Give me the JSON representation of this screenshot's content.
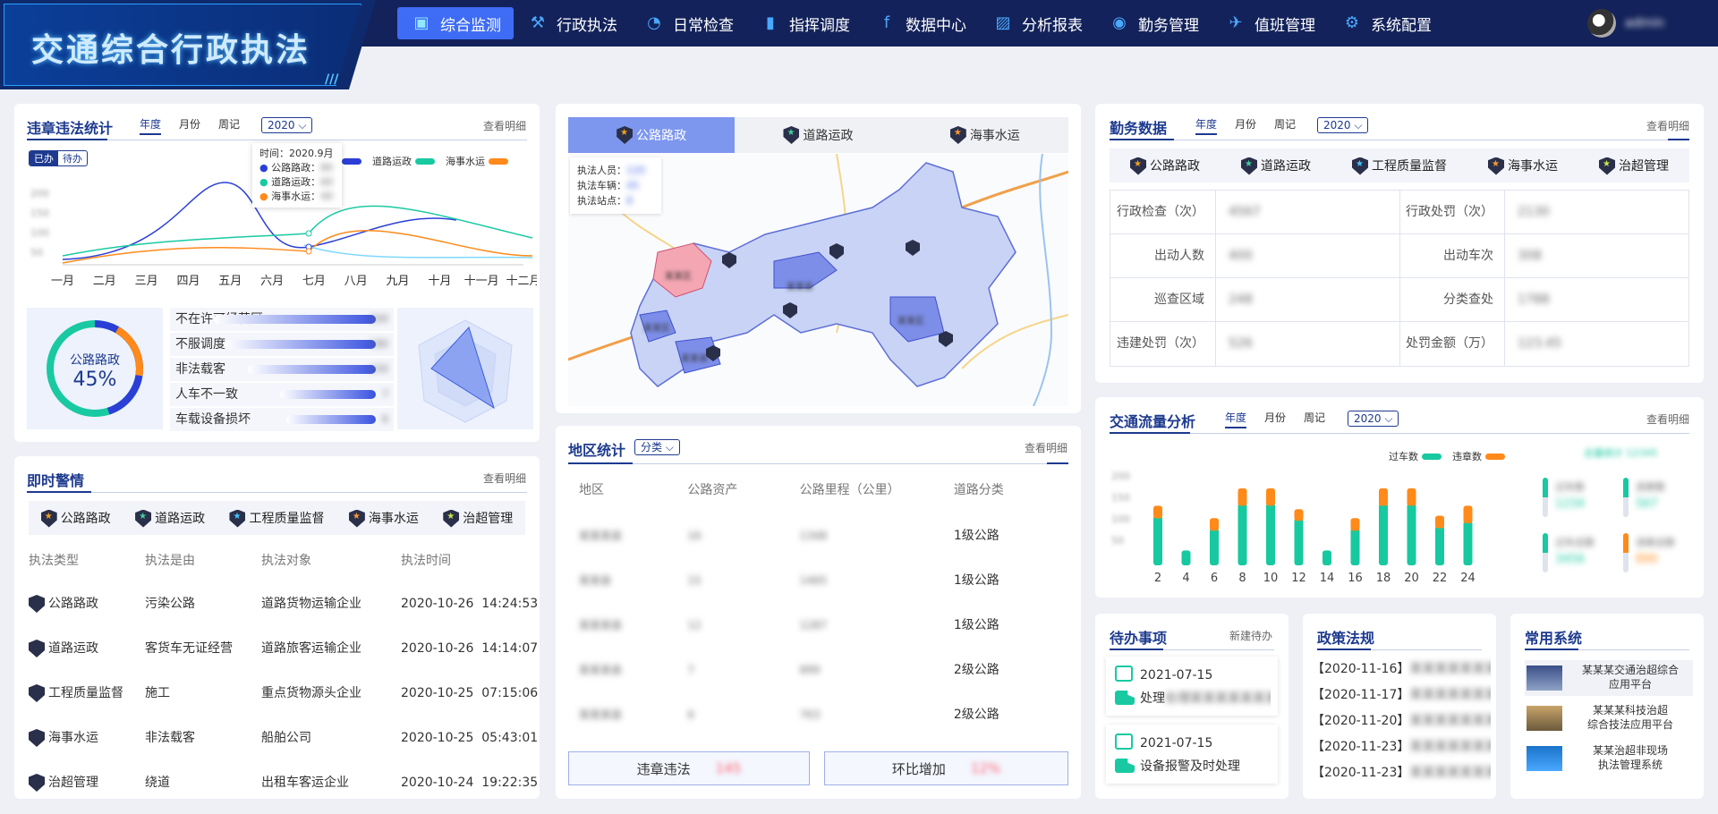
{
  "app": {
    "title": "交通综合行政执法",
    "stripes": "///"
  },
  "nav": [
    {
      "label": "综合监测",
      "icon": "cube-icon",
      "active": true
    },
    {
      "label": "行政执法",
      "icon": "gavel-icon"
    },
    {
      "label": "日常检查",
      "icon": "pie-icon"
    },
    {
      "label": "指挥调度",
      "icon": "command-icon"
    },
    {
      "label": "数据中心",
      "icon": "facebook-icon"
    },
    {
      "label": "分析报表",
      "icon": "chart-icon"
    },
    {
      "label": "勤务管理",
      "icon": "target-icon"
    },
    {
      "label": "值班管理",
      "icon": "duty-icon"
    },
    {
      "label": "系统配置",
      "icon": "config-icon"
    }
  ],
  "user": {
    "name": "admin"
  },
  "violations": {
    "title": "违章违法统计",
    "tabs": [
      "年度",
      "月份",
      "周记"
    ],
    "year": "2020",
    "more": "查看明细",
    "toggle": [
      "已办",
      "待办"
    ],
    "legend": [
      {
        "name": "公路路政",
        "color": "#2b3fd6"
      },
      {
        "name": "道路运政",
        "color": "#19c9a2"
      },
      {
        "name": "海事水运",
        "color": "#ff8a1a"
      }
    ],
    "months": [
      "一月",
      "二月",
      "三月",
      "四月",
      "五月",
      "六月",
      "七月",
      "八月",
      "九月",
      "十月",
      "十一月",
      "十二月"
    ],
    "yticks": [
      "200",
      "150",
      "100",
      "50"
    ],
    "tooltip": {
      "time": "时间：2020.9月",
      "rows": [
        {
          "label": "公路路政：",
          "value": "80"
        },
        {
          "label": "道路运政：",
          "value": "60"
        },
        {
          "label": "海事水运：",
          "value": "40"
        }
      ]
    },
    "donut": {
      "label": "公路路政",
      "value": "45%",
      "percent": 45
    },
    "rank": [
      {
        "label": "不在许可经营区",
        "value": "200",
        "pct": 0.95
      },
      {
        "label": "不服调度",
        "value": "180",
        "pct": 0.88
      },
      {
        "label": "非法载客",
        "value": "150",
        "pct": 0.74
      },
      {
        "label": "人车不一致",
        "value": "7",
        "pct": 0.54
      },
      {
        "label": "车载设备损坏",
        "value": "6",
        "pct": 0.5
      }
    ]
  },
  "alerts": {
    "title": "即时警情",
    "more": "查看明细",
    "cats": [
      "公路路政",
      "道路运政",
      "工程质量监督",
      "海事水运",
      "治超管理"
    ],
    "headers": [
      "执法类型",
      "执法是由",
      "执法对象",
      "执法时间"
    ],
    "rows": [
      {
        "type": "公路路政",
        "reason": "污染公路",
        "target": "道路货物运输企业",
        "time": "2020-10-26  14:24:53"
      },
      {
        "type": "道路运政",
        "reason": "客货车无证经营",
        "target": "道路旅客运输企业",
        "time": "2020-10-26  14:14:07"
      },
      {
        "type": "工程质量监督",
        "reason": "施工",
        "target": "重点货物源头企业",
        "time": "2020-10-25  07:15:06"
      },
      {
        "type": "海事水运",
        "reason": "非法载客",
        "target": "船舶公司",
        "time": "2020-10-25  05:43:01"
      },
      {
        "type": "治超管理",
        "reason": "绕道",
        "target": "出租车客运企业",
        "time": "2020-10-24  19:22:35"
      }
    ]
  },
  "map": {
    "tabs": [
      "公路路政",
      "道路运政",
      "海事水运"
    ],
    "info": [
      {
        "label": "执法人员：",
        "value": "120"
      },
      {
        "label": "执法车辆：",
        "value": "45"
      },
      {
        "label": "执法站点：",
        "value": "8"
      }
    ],
    "regions": [
      "某某区",
      "某某县",
      "某某区",
      "某某县",
      "某某区"
    ]
  },
  "region": {
    "title": "地区统计",
    "select": "分类",
    "more": "查看明细",
    "headers": [
      "地区",
      "公路资产",
      "公路里程（公里）",
      "道路分类"
    ],
    "rows": [
      {
        "area": "某某某县",
        "asset": "16",
        "mileage": "1348",
        "cls": "1级公路"
      },
      {
        "area": "某某县",
        "asset": "15",
        "mileage": "1465",
        "cls": "1级公路"
      },
      {
        "area": "某某某县",
        "asset": "12",
        "mileage": "1287",
        "cls": "1级公路"
      },
      {
        "area": "某某某县",
        "asset": "7",
        "mileage": "899",
        "cls": "2级公路"
      },
      {
        "area": "某某某县",
        "asset": "6",
        "mileage": "763",
        "cls": "2级公路"
      }
    ],
    "btn1": {
      "label": "违章违法",
      "value": "145"
    },
    "btn2": {
      "label": "环比增加",
      "value": "12%"
    }
  },
  "duty": {
    "title": "勤务数据",
    "tabs": [
      "年度",
      "月份",
      "周记"
    ],
    "year": "2020",
    "more": "查看明细",
    "cats": [
      "公路路政",
      "道路运政",
      "工程质量监督",
      "海事水运",
      "治超管理"
    ],
    "rows": [
      [
        {
          "label": "行政检查（次）",
          "value": "4567"
        },
        {
          "label": "行政处罚（次）",
          "value": "2130"
        }
      ],
      [
        {
          "label": "出动人数",
          "value": "400"
        },
        {
          "label": "出动车次",
          "value": "308"
        }
      ],
      [
        {
          "label": "巡查区域",
          "value": "248"
        },
        {
          "label": "分类查处",
          "value": "1788"
        }
      ],
      [
        {
          "label": "违建处罚（次）",
          "value": "526"
        },
        {
          "label": "处罚金额（万）",
          "value": "123.45"
        }
      ]
    ]
  },
  "traffic": {
    "title": "交通流量分析",
    "tabs": [
      "年度",
      "月份",
      "周记"
    ],
    "year": "2020",
    "more": "查看明细",
    "legend": [
      {
        "name": "过车数",
        "color": "#17c9a0"
      },
      {
        "name": "违章数",
        "color": "#ff8a1a"
      }
    ],
    "summary": "总量统计 12345",
    "yticks": [
      "200",
      "150",
      "100",
      "50"
    ],
    "chart_data": {
      "type": "bar",
      "x": [
        "2",
        "4",
        "6",
        "8",
        "10",
        "12",
        "14",
        "16",
        "18",
        "20",
        "22",
        "24"
      ],
      "series": [
        {
          "name": "过车数",
          "values": [
            100,
            30,
            75,
            125,
            125,
            95,
            30,
            75,
            125,
            125,
            80,
            90
          ]
        },
        {
          "name": "违章数",
          "values": [
            20,
            0,
            20,
            30,
            30,
            18,
            0,
            20,
            30,
            30,
            20,
            30
          ]
        }
      ],
      "ylim": [
        0,
        180
      ]
    },
    "side": [
      {
        "label": "过车数",
        "value": "1234"
      },
      {
        "label": "违章数",
        "value": "567"
      },
      {
        "label": "过车总数",
        "value": "3456"
      },
      {
        "label": "违章总数",
        "value": "890"
      }
    ]
  },
  "todo": {
    "title": "待办事项",
    "new": "新建待办",
    "items": [
      {
        "date": "2021-07-15",
        "text": "处理某某某某某某某某..",
        "blurred": true
      },
      {
        "date": "2021-07-15",
        "text": "设备报警及时处理",
        "blurred": false
      }
    ]
  },
  "policy": {
    "title": "政策法规",
    "items": [
      {
        "date": "【2020-11-16】",
        "text": "某某某某某某某"
      },
      {
        "date": "【2020-11-17】",
        "text": "某某某某某某某"
      },
      {
        "date": "【2020-11-20】",
        "text": "某某某某某某某"
      },
      {
        "date": "【2020-11-23】",
        "text": "某某某某某某某"
      },
      {
        "date": "【2020-11-23】",
        "text": "某某某某某某某"
      }
    ]
  },
  "systems": {
    "title": "常用系统",
    "items": [
      {
        "l1": "某某某交通治超综合",
        "l2": "应用平台"
      },
      {
        "l1": "某某某科技治超",
        "l2": "综合技法应用平台"
      },
      {
        "l1": "某某治超非现场",
        "l2": "执法管理系统"
      }
    ]
  }
}
